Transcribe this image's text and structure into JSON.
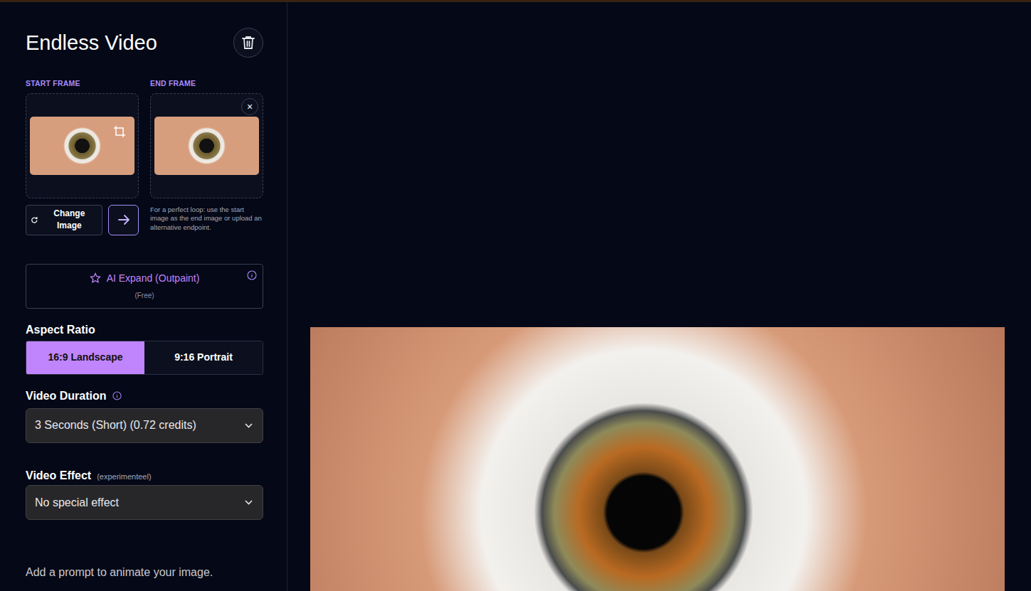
{
  "app": {
    "title": "Endless Video"
  },
  "frames": [
    {
      "label": "START FRAME",
      "kind": "start"
    },
    {
      "label": "END FRAME",
      "kind": "end",
      "close": "×"
    }
  ],
  "change_image": {
    "label": "Change Image"
  },
  "hint": "For a perfect loop: use the start image as the end image or upload an alternative endpoint.",
  "outpaint": {
    "label": "AI Expand (Outpaint)",
    "note": "(Free)"
  },
  "aspect_ratio": {
    "label": "Aspect Ratio",
    "options": [
      {
        "label": "16:9 Landscape",
        "selected": true
      },
      {
        "label": "9:16 Portrait",
        "selected": false
      }
    ]
  },
  "duration": {
    "label": "Video Duration",
    "value": "3 Seconds (Short) (0.72 credits)"
  },
  "effect": {
    "label": "Video Effect",
    "note": "(experimenteel)",
    "value": "No special effect"
  },
  "prompt": {
    "label": "Add a prompt to animate your image."
  }
}
